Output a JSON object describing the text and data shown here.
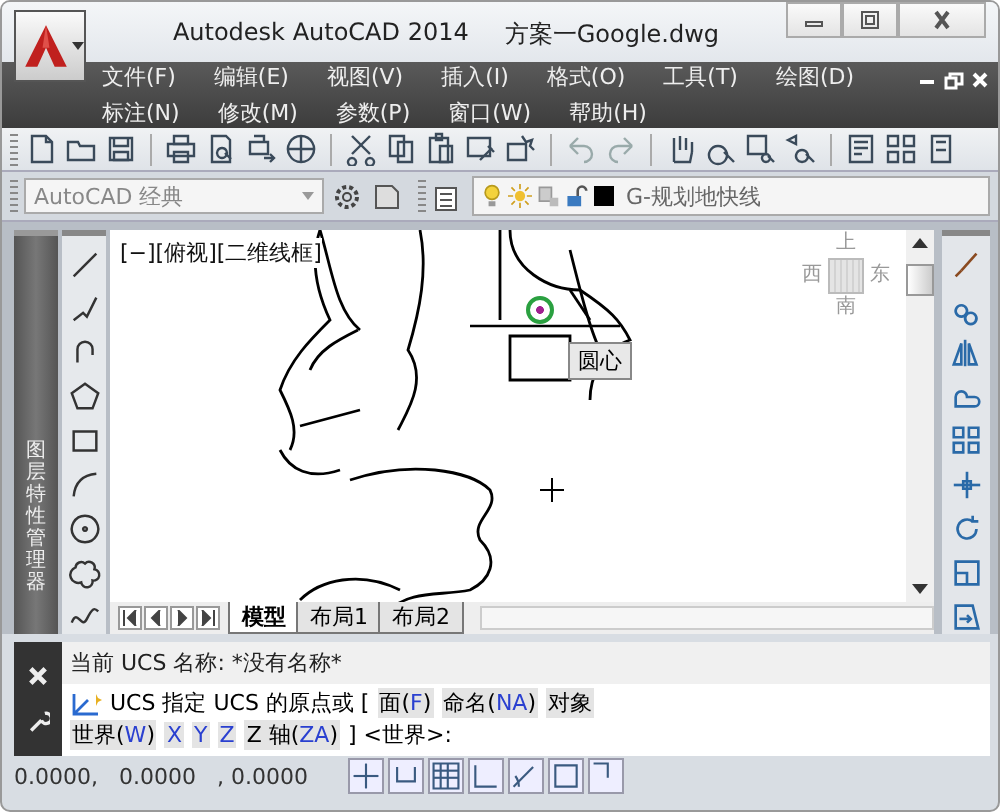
{
  "window": {
    "title": "Autodesk AutoCAD 2014",
    "filename": "方案一Google.dwg"
  },
  "menu_rows": [
    [
      "文件(F)",
      "编辑(E)",
      "视图(V)",
      "插入(I)",
      "格式(O)",
      "工具(T)",
      "绘图(D)"
    ],
    [
      "标注(N)",
      "修改(M)",
      "参数(P)",
      "窗口(W)",
      "帮助(H)"
    ]
  ],
  "workspace": {
    "value": "AutoCAD 经典"
  },
  "layer": {
    "name": "G-规划地快线"
  },
  "palette_title": "图层特性管理器",
  "viewport_label": "[−][俯视][二维线框]",
  "viewcube": {
    "top": "上",
    "left": "西",
    "right": "东",
    "bottom": "南"
  },
  "tooltip": "圆心",
  "layout_tabs": [
    {
      "label": "模型",
      "selected": true
    },
    {
      "label": "布局1",
      "selected": false
    },
    {
      "label": "布局2",
      "selected": false
    }
  ],
  "command": {
    "history": "当前 UCS 名称: *没有名称*",
    "lines": [
      [
        {
          "kind": "plain",
          "text": "UCS 指定 UCS 的原点或 ["
        },
        {
          "kind": "option",
          "parts": [
            {
              "text": "面(",
              "key": false
            },
            {
              "text": "F",
              "key": true
            },
            {
              "text": ")",
              "key": false
            }
          ]
        },
        {
          "kind": "option",
          "parts": [
            {
              "text": "命名(",
              "key": false
            },
            {
              "text": "NA",
              "key": true
            },
            {
              "text": ")",
              "key": false
            }
          ]
        },
        {
          "kind": "option",
          "parts": [
            {
              "text": "对象",
              "key": false
            }
          ]
        }
      ],
      [
        {
          "kind": "option",
          "parts": [
            {
              "text": "世界(",
              "key": false
            },
            {
              "text": "W",
              "key": true
            },
            {
              "text": ")",
              "key": false
            }
          ]
        },
        {
          "kind": "option",
          "parts": [
            {
              "text": "X",
              "key": true
            }
          ]
        },
        {
          "kind": "option",
          "parts": [
            {
              "text": "Y",
              "key": true
            }
          ]
        },
        {
          "kind": "option",
          "parts": [
            {
              "text": "Z",
              "key": true
            }
          ]
        },
        {
          "kind": "option",
          "parts": [
            {
              "text": "Z 轴(",
              "key": false
            },
            {
              "text": "ZA",
              "key": true
            },
            {
              "text": ")",
              "key": false
            }
          ]
        },
        {
          "kind": "plain",
          "text": "] <世界>:"
        }
      ]
    ]
  },
  "status_bar": {
    "coordinates": "0.0000,   0.0000   , 0.0000"
  }
}
